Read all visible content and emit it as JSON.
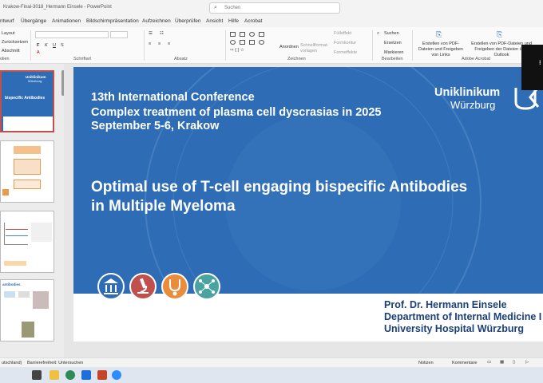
{
  "window": {
    "document_title": "Krakow-Final-3018_Hermann Einsele  -  PowerPoint",
    "search_placeholder": "Suchen"
  },
  "menu_tabs": [
    "ntwurf",
    "Übergänge",
    "Animationen",
    "Bildschirmpräsentation",
    "Aufzeichnen",
    "Überprüfen",
    "Ansicht",
    "Hilfe",
    "Acrobat"
  ],
  "ribbon": {
    "slides_group": {
      "layout": "Layout",
      "reset": "Zurücksetzen",
      "section": "Abschnitt",
      "label": "olien"
    },
    "font_label": "Schriftart",
    "paragraph_label": "Absatz",
    "drawing": {
      "arrange": "Anordnen",
      "quick_styles": "Schnellformat-vorlagen",
      "fill": "Fülleffekt",
      "outline": "Formkontur",
      "effects": "Formeffekte",
      "label": "Zeichnen"
    },
    "editing": {
      "find": "Suchen",
      "replace": "Ersetzen",
      "select": "Markieren",
      "label": "Bearbeiten"
    },
    "acrobat": {
      "create_share": "Erstellen von PDF-Dateien und Freigeben von Links",
      "create_share_outlook": "Erstellen von PDF-Dateien und Freigeben der Dateien über Outlook",
      "label": "Adobe Acrobat"
    }
  },
  "thumbnails": [
    {
      "slide_number": "1",
      "title_line1": "Uniklinikum",
      "title_line2": "Würzburg",
      "caption": "bispecific Antibodies",
      "selected": true
    },
    {
      "slide_number": "2",
      "selected": false
    },
    {
      "slide_number": "3",
      "selected": false
    },
    {
      "slide_number": "4",
      "header": "antibodies",
      "selected": false
    }
  ],
  "slide": {
    "conference_line1": "13th International Conference",
    "conference_line2": "Complex treatment of plasma cell dyscrasias in 2025",
    "conference_line3": "September 5-6, Krakow",
    "title_line1": "Optimal use of T-cell engaging bispecific Antibodies",
    "title_line2": "in Multiple Myeloma",
    "logo_name": "Uniklinikum",
    "logo_city": "Würzburg",
    "presenter": "Prof. Dr. Hermann Einsele",
    "department": "Department of Internal Medicine I",
    "hospital": "University Hospital Würzburg",
    "icon_names": [
      "institution-icon",
      "microscope-icon",
      "stethoscope-icon",
      "network-icon"
    ],
    "accent_color": "#2e6db5"
  },
  "status": {
    "language_line1": "utschland)",
    "accessibility": "Barrierefreiheit: Untersuchen",
    "notes": "Notizen",
    "comments": "Kommentare"
  }
}
